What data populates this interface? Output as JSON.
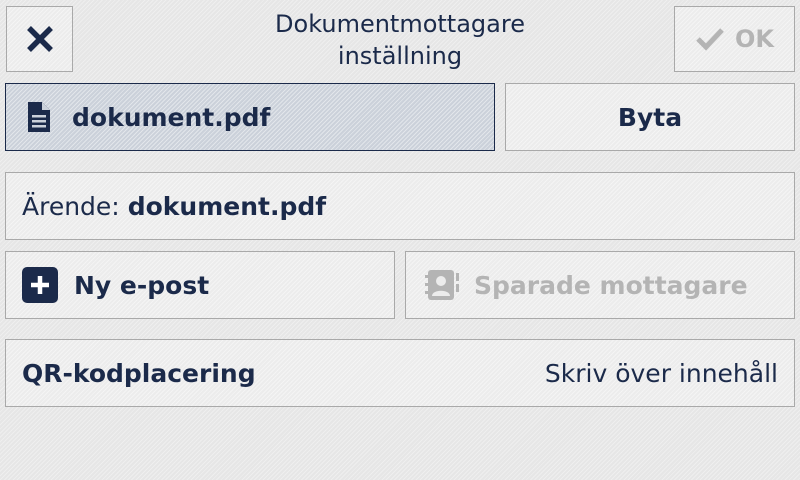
{
  "header": {
    "title_line1": "Dokumentmottagare",
    "title_line2": "inställning",
    "ok_label": "OK"
  },
  "file": {
    "name": "dokument.pdf",
    "change_label": "Byta"
  },
  "subject": {
    "label": "Ärende:",
    "value": "dokument.pdf"
  },
  "recipients": {
    "new_email_label": "Ny e-post",
    "saved_label": "Sparade mottagare"
  },
  "qr": {
    "label": "QR-kodplacering",
    "value": "Skriv över innehåll"
  },
  "icons": {
    "close": "close-icon",
    "ok": "checkmark-icon",
    "document": "document-icon",
    "add": "plus-icon",
    "contacts": "address-book-icon"
  },
  "colors": {
    "text": "#1b2a4a",
    "disabled": "#b4b4b4",
    "selected_bg": "#cbd1da"
  }
}
